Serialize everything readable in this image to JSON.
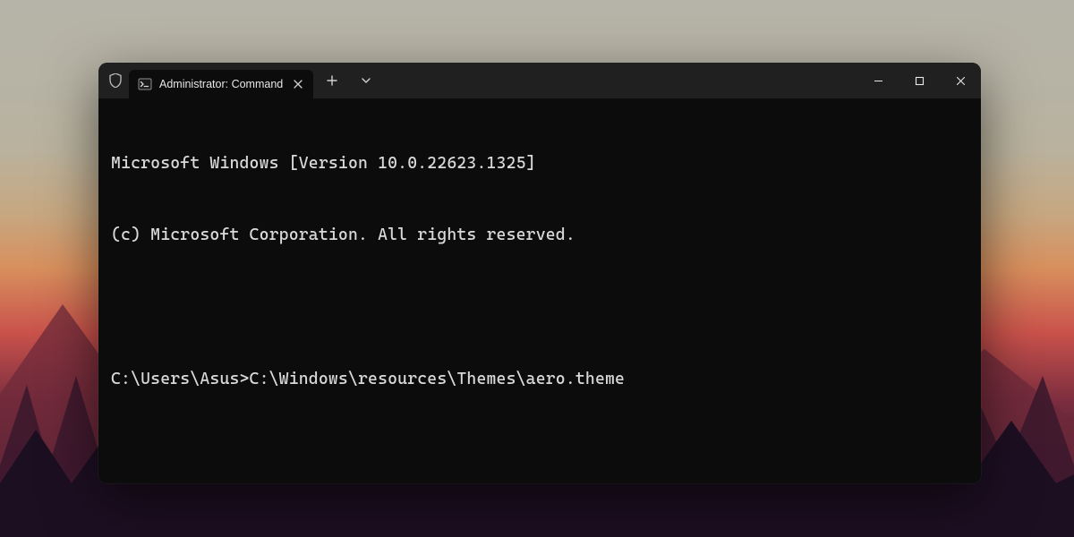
{
  "window": {
    "tab": {
      "title": "Administrator: Command",
      "icon": "cmd-icon"
    },
    "controls": {
      "minimize": "minimize",
      "maximize": "maximize",
      "close": "close"
    }
  },
  "terminal": {
    "lines": [
      "Microsoft Windows [Version 10.0.22623.1325]",
      "(c) Microsoft Corporation. All rights reserved.",
      "",
      "C:\\Users\\Asus>C:\\Windows\\resources\\Themes\\aero.theme"
    ]
  },
  "colors": {
    "window_bg": "#0c0c0c",
    "titlebar_bg": "#202020",
    "text": "#d9d9d9"
  }
}
